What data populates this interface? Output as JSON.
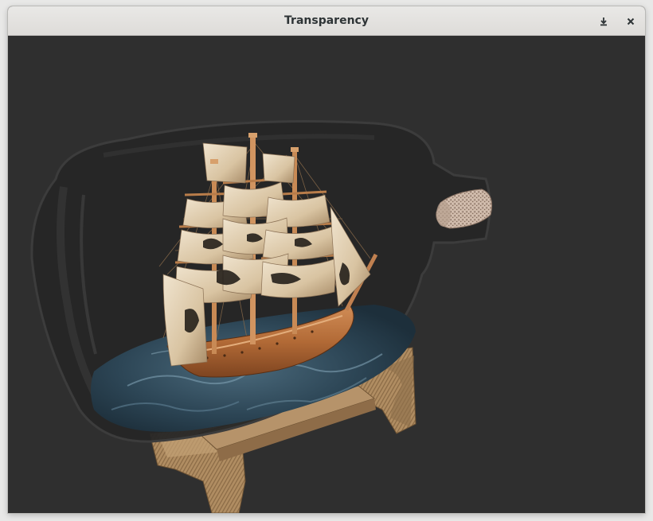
{
  "window": {
    "title": "Transparency",
    "buttons": [
      {
        "name": "minimize",
        "icon": "minimize-icon"
      },
      {
        "name": "close",
        "icon": "close-icon"
      }
    ]
  },
  "viewport": {
    "background_color": "#2f2f2f",
    "objects": [
      {
        "name": "glass-bottle",
        "icon": "bottle-glass"
      },
      {
        "name": "cork",
        "icon": "cork"
      },
      {
        "name": "sailing-ship",
        "icon": "ship"
      },
      {
        "name": "sea-base",
        "icon": "water"
      },
      {
        "name": "wooden-stand",
        "icon": "stand"
      }
    ]
  }
}
